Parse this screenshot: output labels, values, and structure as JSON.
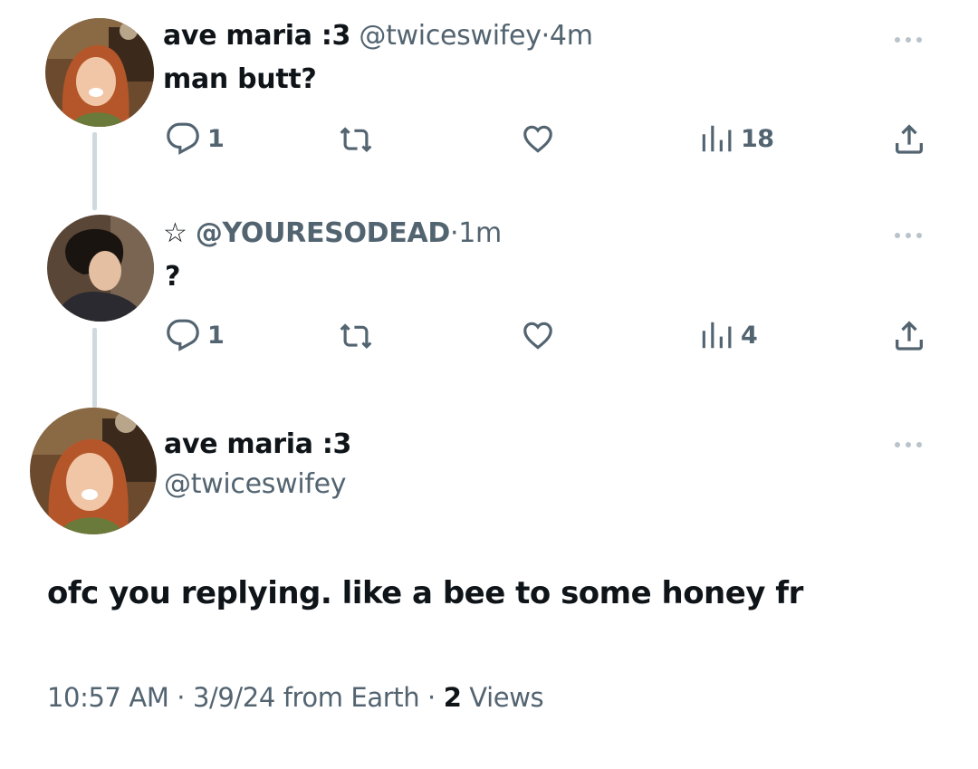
{
  "thread": [
    {
      "display_name": "ave maria :3",
      "handle": "@twiceswifey",
      "separator": "·",
      "time": "4m",
      "text": "man butt?",
      "avatar_icon": "avatar-redhead-photo",
      "actions": {
        "reply_count": "1",
        "retweet_count": "",
        "like_count": "",
        "views_count": "18"
      }
    },
    {
      "display_name": "☆",
      "handle": "@YOURESODEAD",
      "separator": "·",
      "time": "1m",
      "text": "?",
      "avatar_icon": "avatar-darkhair-photo",
      "actions": {
        "reply_count": "1",
        "retweet_count": "",
        "like_count": "",
        "views_count": "4"
      }
    }
  ],
  "focused_tweet": {
    "display_name": "ave maria :3",
    "handle": "@twiceswifey",
    "text": "ofc you replying. like a bee to some honey fr",
    "time": "10:57 AM",
    "separator": "·",
    "date": "3/9/24",
    "source": "from Earth",
    "views_count": "2",
    "views_label": "Views",
    "avatar_icon": "avatar-redhead-photo"
  },
  "colors": {
    "text": "#0f1419",
    "muted": "#536471",
    "thread_line": "#cfd9de"
  }
}
